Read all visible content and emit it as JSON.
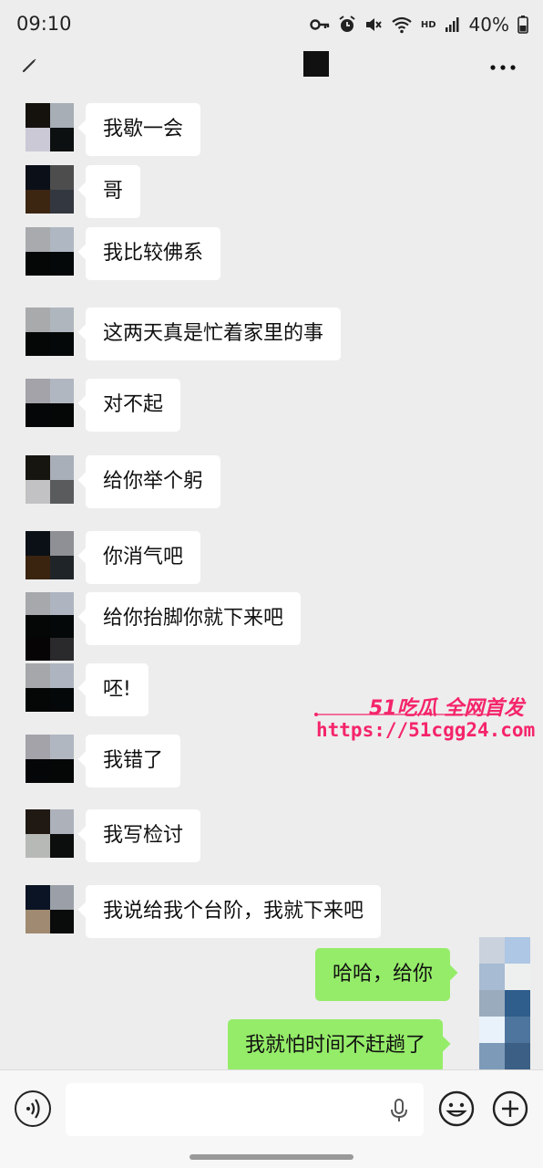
{
  "status_bar": {
    "time": "09:10",
    "battery": "40%",
    "icons": [
      "key-icon",
      "alarm-icon",
      "mute-icon",
      "wifi-icon",
      "hd-icon",
      "signal-icon",
      "battery-icon"
    ],
    "hd_label": "HD"
  },
  "header": {
    "icons": [
      "edit-icon",
      "more-icon"
    ]
  },
  "messages": [
    {
      "text": "我歇一会"
    },
    {
      "text": "哥"
    },
    {
      "text": "我比较佛系"
    },
    {
      "text": "这两天真是忙着家里的事"
    },
    {
      "text": "对不起"
    },
    {
      "text": "给你举个躬"
    },
    {
      "text": "你消气吧"
    },
    {
      "text": "给你抬脚你就下来吧"
    },
    {
      "text": "呸!"
    },
    {
      "text": "我错了"
    },
    {
      "text": "我写检讨"
    },
    {
      "text": "我说给我个台阶，我就下来吧"
    }
  ],
  "outgoing": [
    {
      "text": "哈哈，给你"
    },
    {
      "text": "我就怕时间不赶趟了"
    }
  ],
  "watermark": {
    "title": "51吃瓜 全网首发",
    "url": "https://51cgg24.com"
  },
  "input_bar": {
    "icons": [
      "voice-icon",
      "mic-icon",
      "emoji-icon",
      "plus-icon"
    ]
  },
  "colors": {
    "background": "#ededed",
    "incoming_bubble": "#ffffff",
    "outgoing_bubble": "#95ec69",
    "watermark": "#f5246b"
  }
}
